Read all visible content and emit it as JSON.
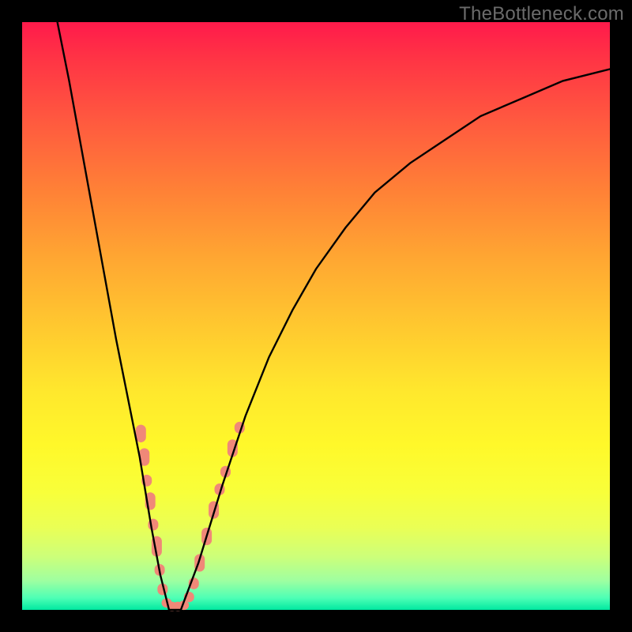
{
  "watermark": "TheBottleneck.com",
  "chart_data": {
    "type": "line",
    "title": "",
    "xlabel": "",
    "ylabel": "",
    "xlim": [
      0,
      100
    ],
    "ylim": [
      0,
      100
    ],
    "grid": false,
    "series": [
      {
        "name": "bottleneck-curve",
        "x": [
          6,
          8,
          10,
          12,
          14,
          16,
          18,
          20,
          22,
          23.5,
          25,
          27,
          30,
          34,
          38,
          42,
          46,
          50,
          55,
          60,
          66,
          72,
          78,
          85,
          92,
          100
        ],
        "y": [
          100,
          90,
          79,
          68,
          57,
          46,
          36,
          26,
          14,
          6,
          0,
          0,
          8,
          21,
          33,
          43,
          51,
          58,
          65,
          71,
          76,
          80,
          84,
          87,
          90,
          92
        ],
        "color": "#000000"
      }
    ],
    "markers": [
      {
        "name": "highlight-dots",
        "color": "#f08878",
        "shape": "rounded-rect",
        "points": [
          {
            "x": 20.2,
            "y": 30.0,
            "len": 3.0
          },
          {
            "x": 20.8,
            "y": 26.0,
            "len": 3.0
          },
          {
            "x": 21.2,
            "y": 22.0,
            "len": 2.0
          },
          {
            "x": 21.8,
            "y": 18.5,
            "len": 3.0
          },
          {
            "x": 22.3,
            "y": 14.5,
            "len": 2.0
          },
          {
            "x": 22.9,
            "y": 10.8,
            "len": 3.5
          },
          {
            "x": 23.4,
            "y": 6.8,
            "len": 2.0
          },
          {
            "x": 23.9,
            "y": 3.5,
            "len": 2.0
          },
          {
            "x": 24.6,
            "y": 1.2,
            "len": 1.6
          },
          {
            "x": 25.5,
            "y": 0.6,
            "len": 1.6
          },
          {
            "x": 26.5,
            "y": 0.6,
            "len": 1.6
          },
          {
            "x": 27.5,
            "y": 0.8,
            "len": 1.6
          },
          {
            "x": 28.4,
            "y": 2.2,
            "len": 1.8
          },
          {
            "x": 29.2,
            "y": 4.5,
            "len": 2.0
          },
          {
            "x": 30.2,
            "y": 8.0,
            "len": 3.0
          },
          {
            "x": 31.4,
            "y": 12.5,
            "len": 3.0
          },
          {
            "x": 32.6,
            "y": 17.0,
            "len": 3.0
          },
          {
            "x": 33.6,
            "y": 20.5,
            "len": 2.0
          },
          {
            "x": 34.6,
            "y": 23.5,
            "len": 2.0
          },
          {
            "x": 35.8,
            "y": 27.5,
            "len": 3.0
          },
          {
            "x": 37.0,
            "y": 31.0,
            "len": 2.0
          }
        ]
      }
    ]
  }
}
